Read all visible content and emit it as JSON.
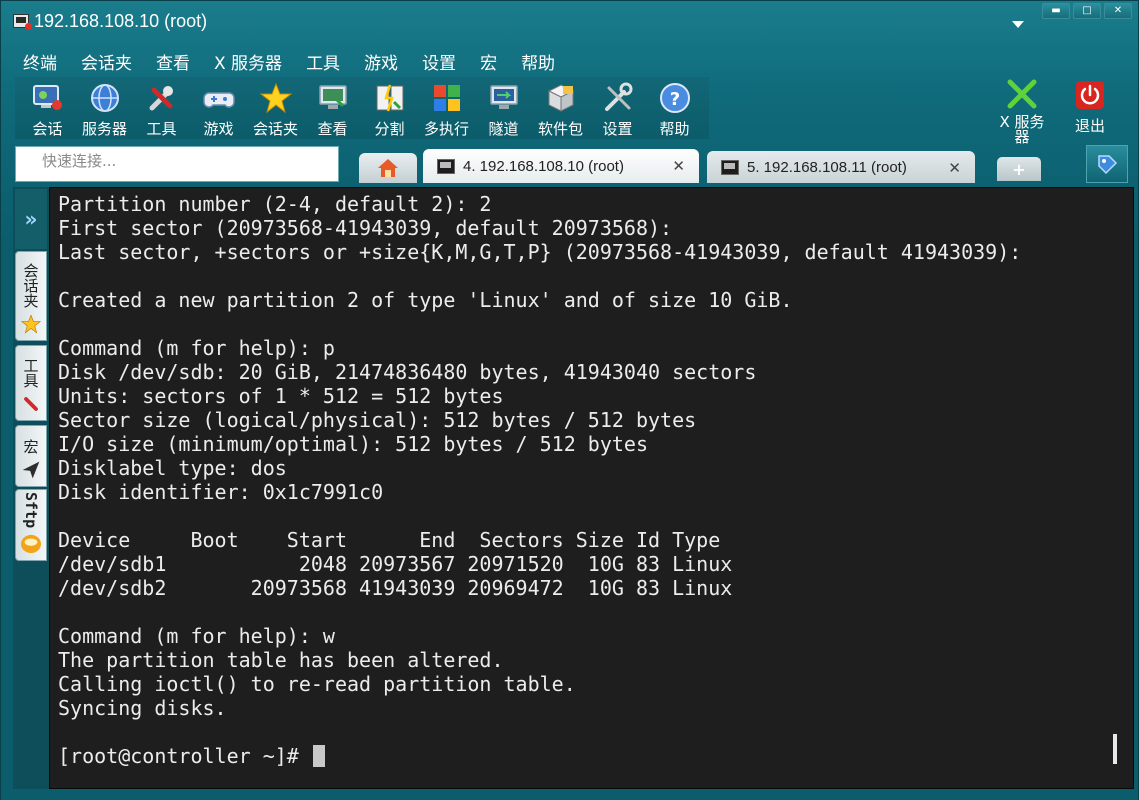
{
  "window": {
    "title": "192.168.108.10 (root)",
    "controls": {
      "minimize": "▬",
      "maximize": "□",
      "close": "✕"
    }
  },
  "menu": [
    "终端",
    "会话夹",
    "查看",
    "X 服务器",
    "工具",
    "游戏",
    "设置",
    "宏",
    "帮助"
  ],
  "toolbar": [
    {
      "label": "会话",
      "icon": "session-icon"
    },
    {
      "label": "服务器",
      "icon": "server-globe-icon"
    },
    {
      "label": "工具",
      "icon": "tools-icon"
    },
    {
      "label": "游戏",
      "icon": "gamepad-icon"
    },
    {
      "label": "会话夹",
      "icon": "star-icon"
    },
    {
      "label": "查看",
      "icon": "monitor-icon"
    },
    {
      "label": "分割",
      "icon": "split-icon"
    },
    {
      "label": "多执行",
      "icon": "multi-exec-icon"
    },
    {
      "label": "隧道",
      "icon": "tunnel-icon"
    },
    {
      "label": "软件包",
      "icon": "packages-icon"
    },
    {
      "label": "设置",
      "icon": "settings-icon"
    },
    {
      "label": "帮助",
      "icon": "help-icon"
    }
  ],
  "right_toolbar": {
    "xserver_label": "X 服务器",
    "exit_label": "退出"
  },
  "quick_connect": {
    "placeholder": "快速连接..."
  },
  "tabs": [
    {
      "label": "4. 192.168.108.10 (root)",
      "active": true
    },
    {
      "label": "5. 192.168.108.11 (root)",
      "active": false
    }
  ],
  "tab_close": "✕",
  "add_tab": "+",
  "sidebar": {
    "expand": "»",
    "tabs": [
      "会话夹",
      "工具",
      "宏",
      "Sftp"
    ]
  },
  "terminal": {
    "lines": [
      "Partition number (2-4, default 2): 2",
      "First sector (20973568-41943039, default 20973568):",
      "Last sector, +sectors or +size{K,M,G,T,P} (20973568-41943039, default 41943039):",
      "",
      "Created a new partition 2 of type 'Linux' and of size 10 GiB.",
      "",
      "Command (m for help): p",
      "Disk /dev/sdb: 20 GiB, 21474836480 bytes, 41943040 sectors",
      "Units: sectors of 1 * 512 = 512 bytes",
      "Sector size (logical/physical): 512 bytes / 512 bytes",
      "I/O size (minimum/optimal): 512 bytes / 512 bytes",
      "Disklabel type: dos",
      "Disk identifier: 0x1c7991c0",
      "",
      "Device     Boot    Start      End  Sectors Size Id Type",
      "/dev/sdb1           2048 20973567 20971520  10G 83 Linux",
      "/dev/sdb2       20973568 41943039 20969472  10G 83 Linux",
      "",
      "Command (m for help): w",
      "The partition table has been altered.",
      "Calling ioctl() to re-read partition table.",
      "Syncing disks.",
      ""
    ],
    "prompt": "[root@controller ~]# "
  },
  "colors": {
    "frame": "#0b5d6c",
    "terminal_bg": "#1e1e1e",
    "terminal_fg": "#ececec"
  }
}
